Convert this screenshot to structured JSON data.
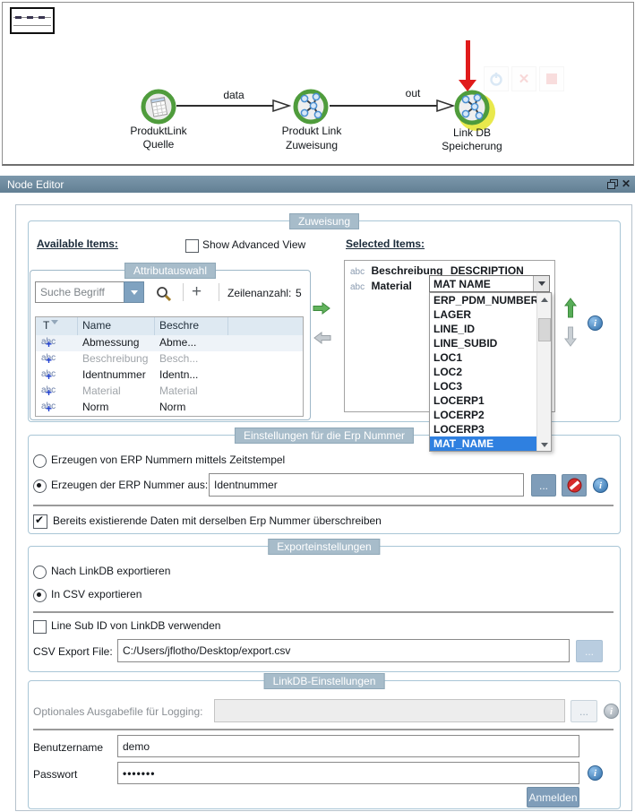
{
  "panel": {
    "title": "Node Editor"
  },
  "icons": {
    "close": "✕",
    "plus": "+",
    "check": "✔"
  },
  "canvas": {
    "nodes": [
      {
        "line1": "ProduktLink",
        "line2": "Quelle"
      },
      {
        "line1": "Produkt Link",
        "line2": "Zuweisung"
      },
      {
        "line1": "Link DB",
        "line2": "Speicherung"
      }
    ],
    "edges": [
      {
        "label": "data"
      },
      {
        "label": "out"
      }
    ]
  },
  "zuweisung": {
    "title": "Zuweisung",
    "available_label": "Available Items:",
    "advanced_label": "Show Advanced View",
    "selected_label": "Selected Items:",
    "attribut": {
      "title": "Attributauswahl",
      "search_text": "Suche Begriff",
      "rowcount_label": "Zeilenanzahl:",
      "rowcount_value": "5",
      "col_t": "T",
      "col_name": "Name",
      "col_desc": "Beschre",
      "rows": [
        {
          "type": "abc",
          "name": "Abmessung",
          "desc": "Abme..."
        },
        {
          "type": "abc",
          "name": "Beschreibung",
          "desc": "Besch..."
        },
        {
          "type": "abc",
          "name": "Identnummer",
          "desc": "Identn..."
        },
        {
          "type": "abc",
          "name": "Material",
          "desc": "Material"
        },
        {
          "type": "abc",
          "name": "Norm",
          "desc": "Norm"
        }
      ]
    },
    "selected_rows": [
      {
        "type": "abc",
        "name": "Beschreibung",
        "value": "DESCRIPTION"
      },
      {
        "type": "abc",
        "name": "Material",
        "value": "MAT NAME"
      }
    ],
    "dropdown": {
      "options": [
        "ERP_PDM_NUMBER",
        "LAGER",
        "LINE_ID",
        "LINE_SUBID",
        "LOC1",
        "LOC2",
        "LOC3",
        "LOCERP1",
        "LOCERP2",
        "LOCERP3",
        "MAT_NAME"
      ],
      "selected": "MAT_NAME"
    }
  },
  "erp": {
    "title": "Einstellungen für die Erp Nummer",
    "radio_timestamp": "Erzeugen von ERP Nummern mittels Zeitstempel",
    "radio_from": "Erzeugen der ERP Nummer aus:",
    "from_value": "Identnummer",
    "browse_label": "...",
    "overwrite_label": "Bereits existierende Daten mit derselben Erp Nummer überschreiben"
  },
  "export": {
    "title": "Exporteinstellungen",
    "radio_linkdb": "Nach LinkDB exportieren",
    "radio_csv": "In CSV exportieren",
    "line_sub_label": "Line Sub ID von LinkDB verwenden",
    "csv_label": "CSV Export File:",
    "csv_value": "C:/Users/jflotho/Desktop/export.csv",
    "browse_label": "..."
  },
  "linkdb": {
    "title": "LinkDB-Einstellungen",
    "logging_label": "Optionales Ausgabefile für Logging:",
    "logging_value": "",
    "browse_label": "...",
    "username_label": "Benutzername",
    "username_value": "demo",
    "password_label": "Passwort",
    "password_value": "•••••••",
    "login_label": "Anmelden"
  },
  "colors": {
    "titlebar": "#6d8ba0",
    "group_label_bg": "#a7bcca",
    "button_bg": "#7f9db9",
    "dropdown_highlight": "#2f80e0",
    "node_ring_green": "#4f9c3c",
    "selection_halo_yellow": "#e9e94c",
    "red_arrow": "#e01b1b"
  }
}
